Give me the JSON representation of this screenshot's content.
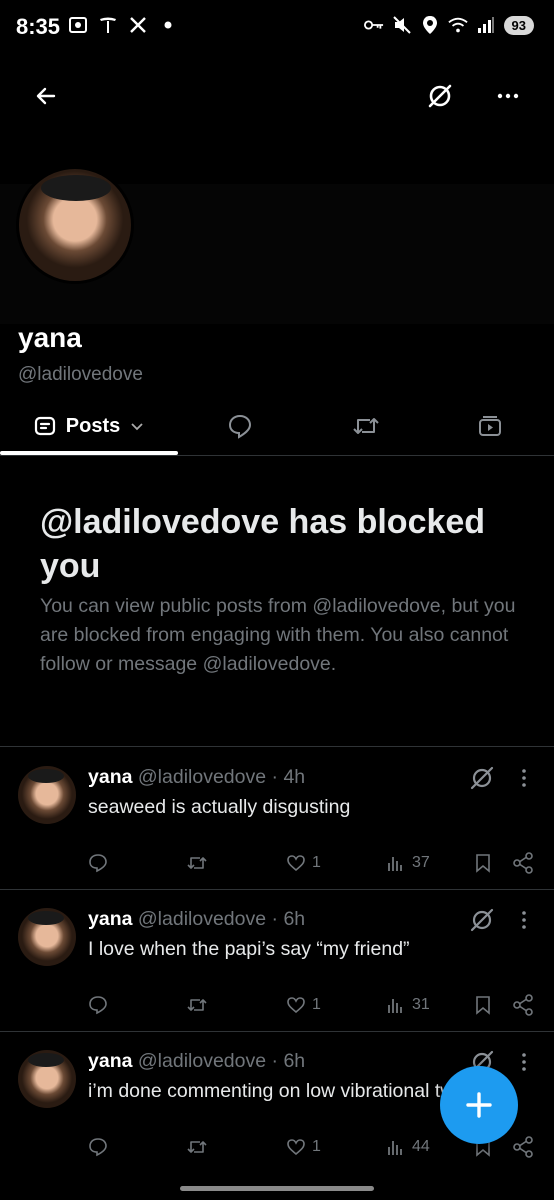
{
  "status_bar": {
    "time": "8:35",
    "battery": "93",
    "left_icons": [
      "screenshot-icon",
      "tesla-icon",
      "x-icon",
      "dot-icon"
    ],
    "right_icons": [
      "key-icon",
      "mute-icon",
      "location-icon",
      "wifi-icon",
      "signal-icon"
    ]
  },
  "profile": {
    "name": "yana",
    "handle": "@ladilovedove"
  },
  "tabs": {
    "posts_label": "Posts"
  },
  "blocked": {
    "title": "@ladilovedove has blocked you",
    "text": "You can view public posts from @ladilovedove, but you are blocked from engaging with them. You also cannot follow or message @ladilovedove."
  },
  "tweets": [
    {
      "name": "yana",
      "handle": "@ladilovedove",
      "sep": " · ",
      "time": "4h",
      "text": "seaweed is actually disgusting",
      "likes": "1",
      "views": "37"
    },
    {
      "name": "yana",
      "handle": "@ladilovedove",
      "sep": " · ",
      "time": "6h",
      "text": "I love when the papi’s say “my friend”",
      "likes": "1",
      "views": "31"
    },
    {
      "name": "yana",
      "handle": "@ladilovedove",
      "sep": " · ",
      "time": "6h",
      "text": "i’m done commenting on low vibrational tweets",
      "likes": "1",
      "views": "44"
    }
  ],
  "colors": {
    "accent": "#1d9bf0",
    "muted": "#71767b",
    "border": "#2f3336"
  }
}
